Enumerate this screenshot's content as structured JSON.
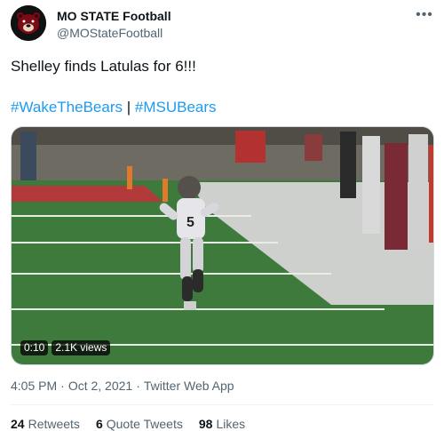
{
  "author": {
    "display_name": "MO STATE Football",
    "handle": "@MOStateFootball",
    "avatar_icon": "bear-logo-icon"
  },
  "more_icon": "more-options-icon",
  "tweet": {
    "text": "Shelley finds Latulas for 6!!!",
    "hashtag_1": "#WakeTheBears",
    "hashtag_sep": "|",
    "hashtag_2": "#MSUBears"
  },
  "video": {
    "time": "0:10",
    "views": "2.1K views"
  },
  "meta": {
    "time": "4:05 PM",
    "date": "Oct 2, 2021",
    "app": "Twitter Web App"
  },
  "stats": {
    "retweets_count": "24",
    "retweets_label": "Retweets",
    "quotes_count": "6",
    "quotes_label": "Quote Tweets",
    "likes_count": "98",
    "likes_label": "Likes"
  },
  "colors": {
    "link": "#1d9bf0",
    "text": "#0f1419",
    "muted": "#536471",
    "brand": "#5e0009"
  }
}
